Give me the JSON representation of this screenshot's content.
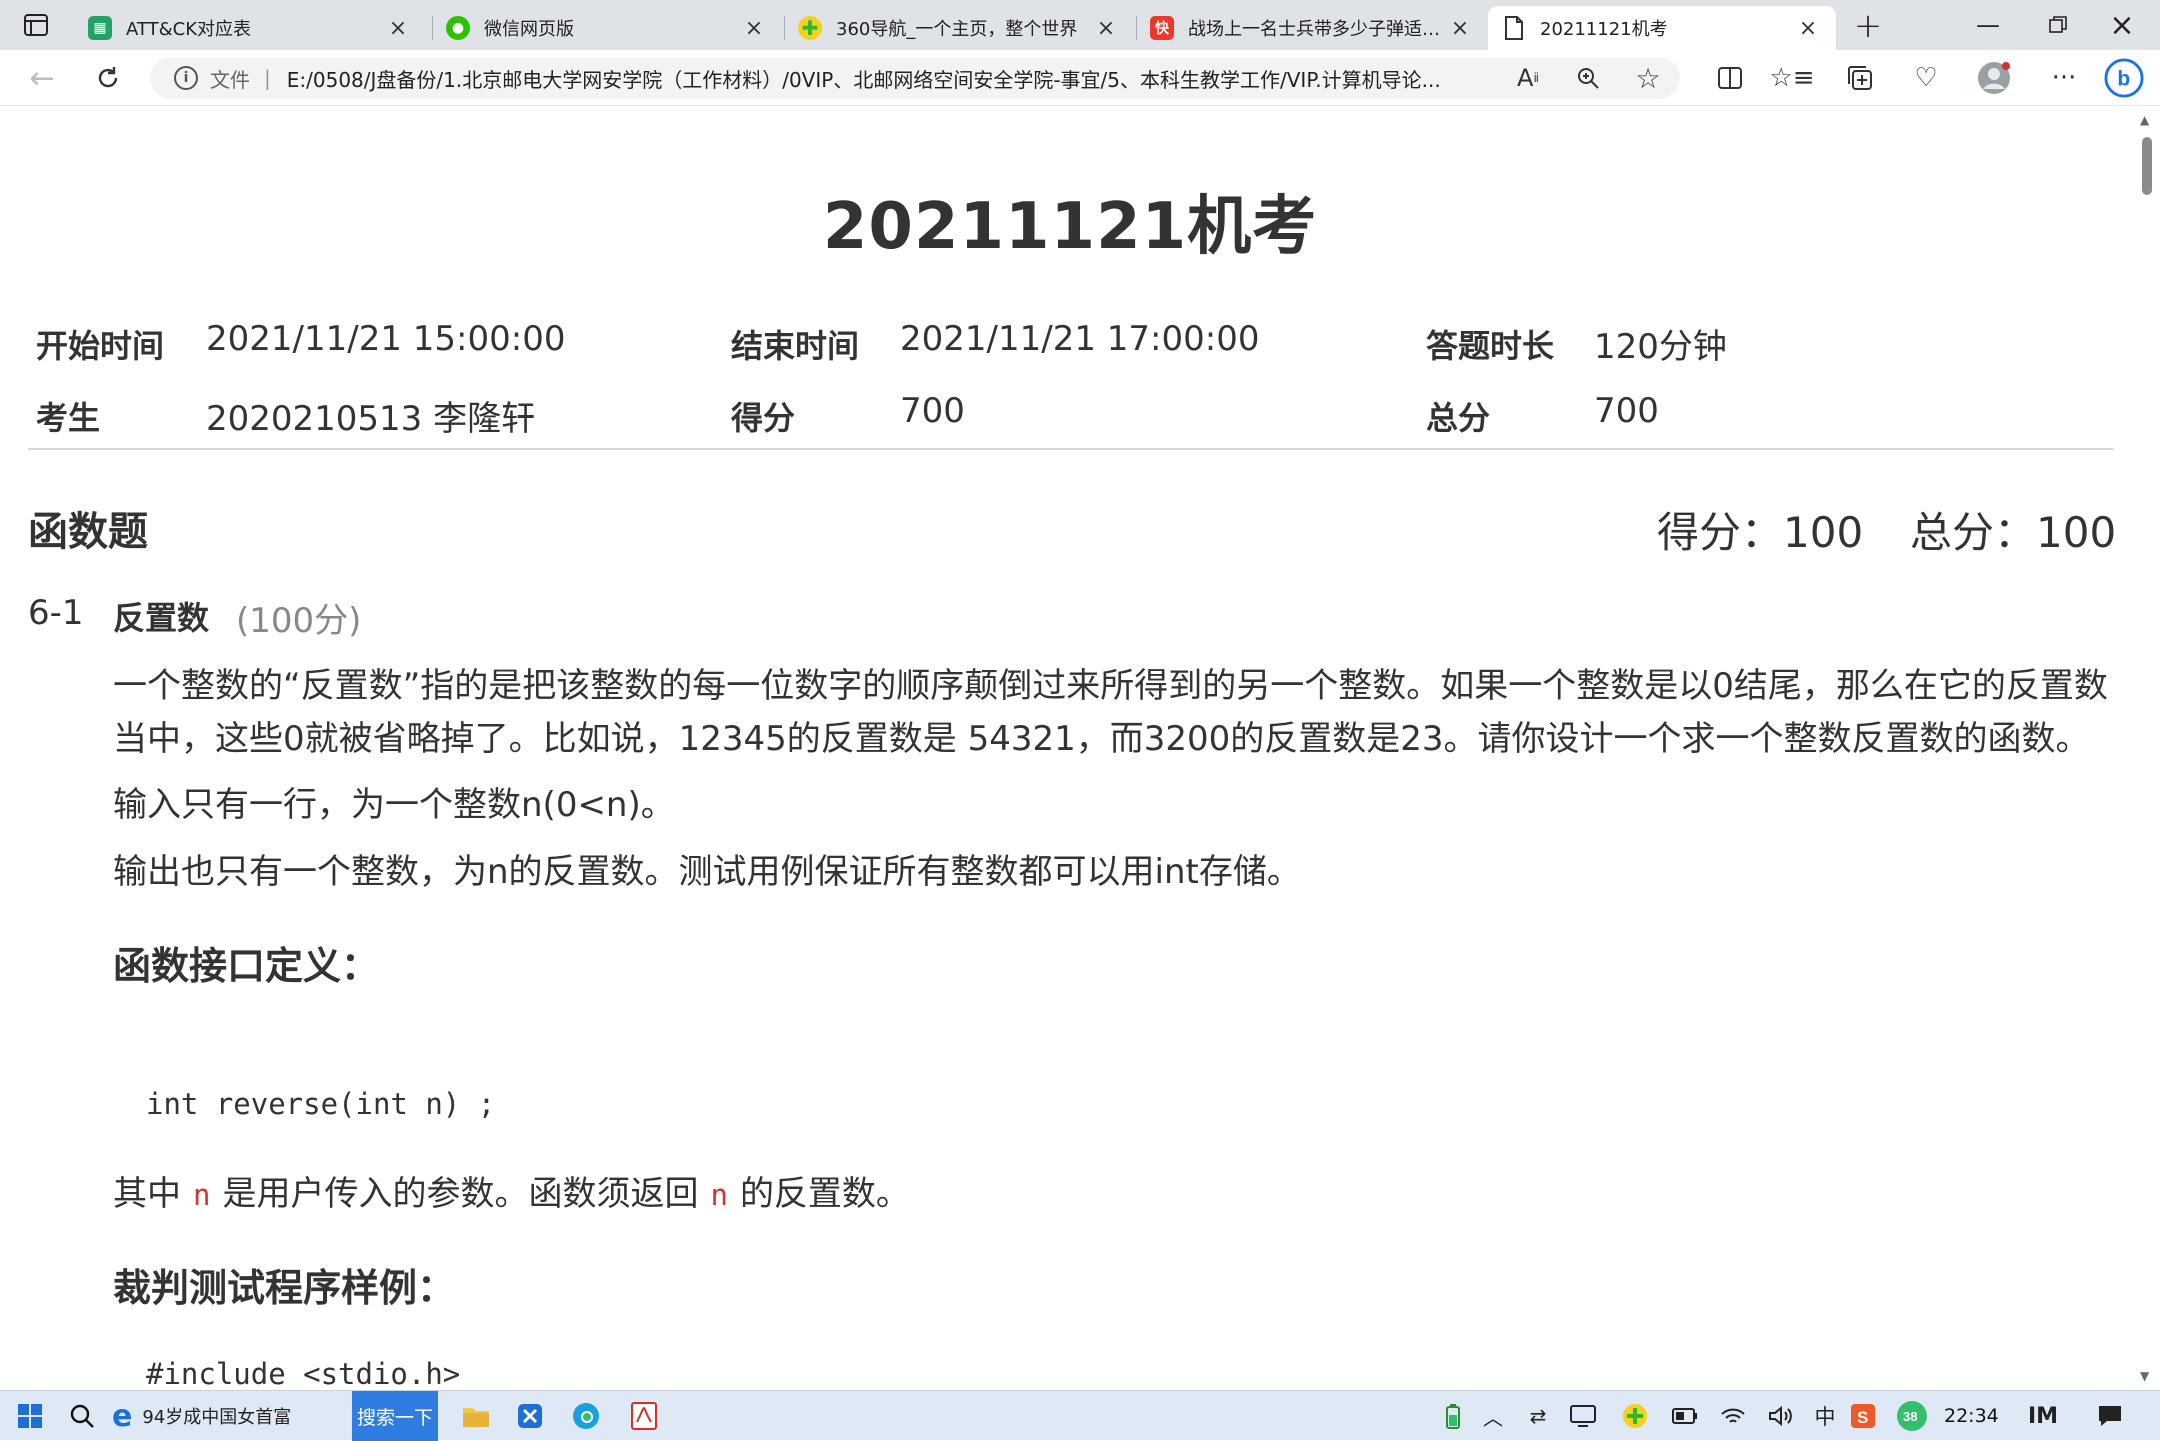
{
  "browser": {
    "tabs": [
      {
        "title": "ATT&CK对应表",
        "icon": "sheet-icon",
        "color": "#21a366"
      },
      {
        "title": "微信网页版",
        "icon": "wechat-icon",
        "color": "#2dc100"
      },
      {
        "title": "360导航_一个主页，整个世界",
        "icon": "360-icon",
        "color": "#2eb82e"
      },
      {
        "title": "战场上一名士兵带多少子弹适合?",
        "icon": "zhihu-icon",
        "color": "#e8382f"
      },
      {
        "title": "20211121机考",
        "icon": "file-icon",
        "color": "#444444"
      }
    ],
    "address": {
      "scheme": "文件",
      "url": "E:/0508/J盘备份/1.北京邮电大学网安学院（工作材料）/0VIP、北邮网络空间安全学院-事宜/5、本科生教学工作/VIP.计算机导论..."
    }
  },
  "exam": {
    "title": "20211121机考",
    "start_label": "开始时间",
    "start_value": "2021/11/21 15:00:00",
    "end_label": "结束时间",
    "end_value": "2021/11/21 17:00:00",
    "duration_label": "答题时长",
    "duration_value": "120分钟",
    "student_label": "考生",
    "student_value": "2020210513 李隆轩",
    "score_label": "得分",
    "score_value": "700",
    "total_label": "总分",
    "total_value": "700"
  },
  "section": {
    "title": "函数题",
    "score": "得分：100",
    "total": "总分：100"
  },
  "question": {
    "number": "6-1",
    "name": "反置数",
    "points": "(100分)",
    "desc_line1": "一个整数的“反置数”指的是把该整数的每一位数字的顺序颠倒过来所得到的另一个整数。如果一个整数是以0结尾，那么在它的反置数",
    "desc_line2": "当中，这些0就被省略掉了。比如说，12345的反置数是 54321，而3200的反置数是23。请你设计一个求一个整数反置数的函数。",
    "input_desc": "输入只有一行，为一个整数n(0<n)。",
    "output_desc": "输出也只有一个整数，为n的反置数。测试用例保证所有整数都可以用int存储。",
    "interface_heading": "函数接口定义：",
    "interface_code": "int reverse(int n) ;",
    "param_pre": "其中",
    "param_var": "n",
    "param_mid": "是用户传入的参数。函数须返回",
    "param_var2": "n",
    "param_post": "的反置数。",
    "sample_heading": "裁判测试程序样例：",
    "sample_code": "#include <stdio.h>"
  },
  "taskbar": {
    "news": "94岁成中国女首富",
    "search_btn": "搜索一下",
    "clock": "22:34",
    "ime": "中"
  }
}
